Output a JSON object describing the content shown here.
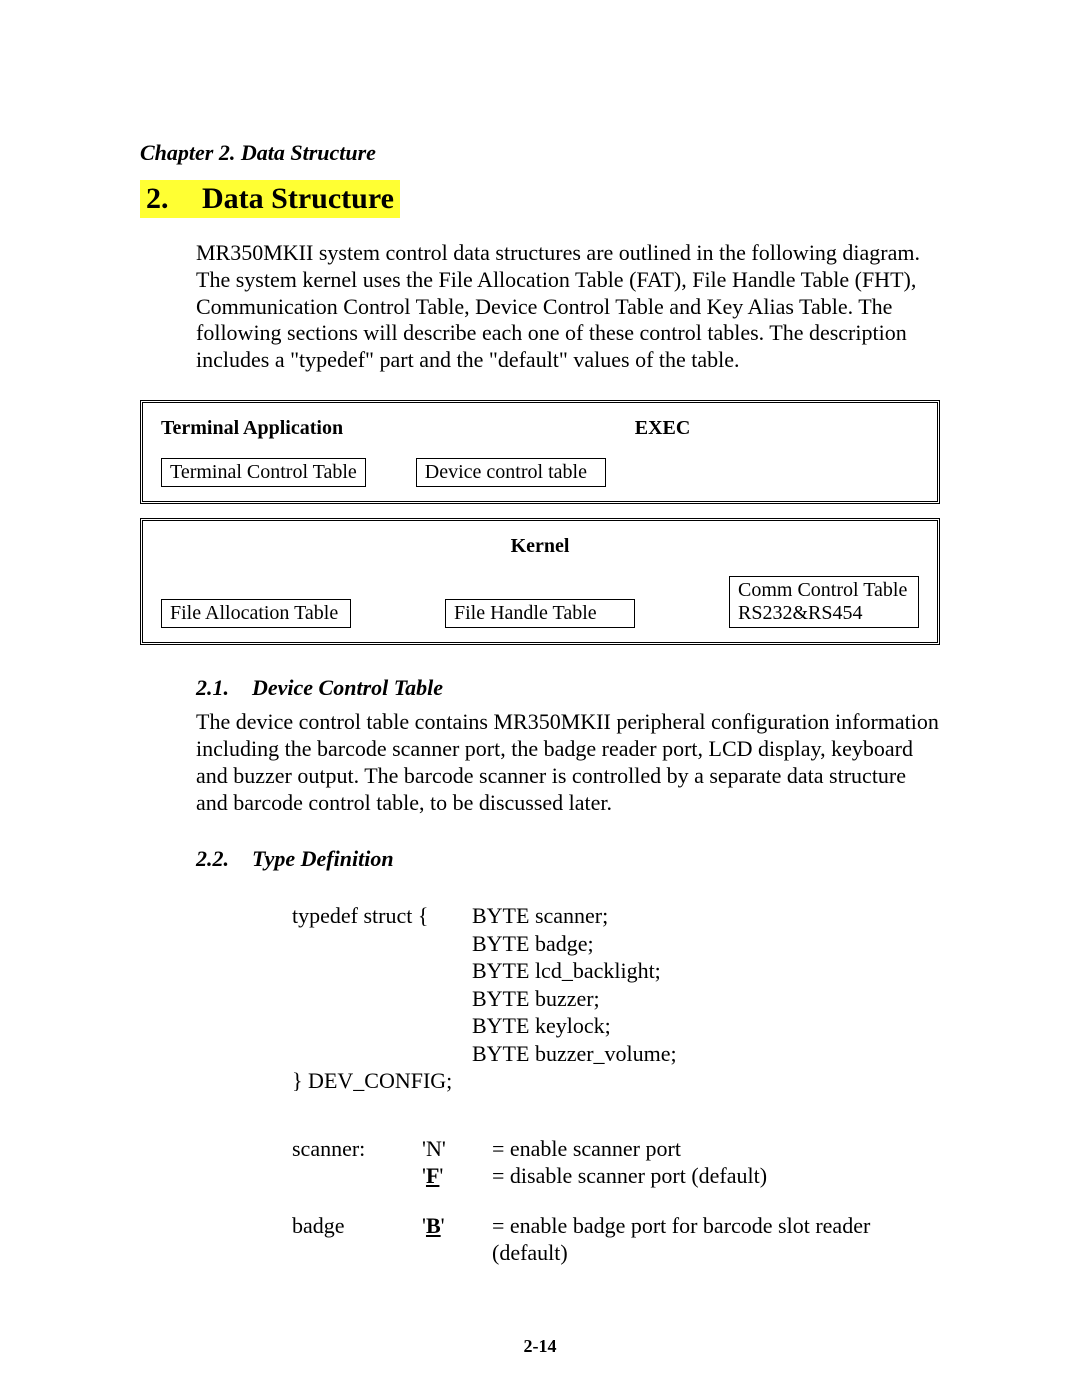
{
  "running_head": "Chapter 2. Data Structure",
  "chapter": {
    "number": "2.",
    "title": "Data Structure"
  },
  "intro_para": "MR350MKII system control data structures are outlined in the following diagram. The system kernel uses the File Allocation Table (FAT), File Handle Table (FHT), Communication Control Table, Device Control Table and Key Alias Table.  The following sections will describe each one of these control tables. The description includes a \"typedef\" part and the \"default\" values of the table.",
  "diagram": {
    "box1": {
      "header_left": "Terminal Application",
      "header_right": "EXEC",
      "cells": [
        "Terminal Control Table",
        "Device control table"
      ]
    },
    "box2": {
      "header_center": "Kernel",
      "cells": [
        "File Allocation Table",
        "File Handle Table",
        {
          "line1": "Comm Control Table",
          "line2": "RS232&RS454"
        }
      ]
    }
  },
  "sections": {
    "s1": {
      "num": "2.1.",
      "title": "Device Control Table",
      "para": "The device control table contains MR350MKII peripheral configuration information including the barcode scanner port, the badge reader port, LCD display, keyboard and buzzer output. The barcode scanner is controlled by a separate data structure and barcode control table, to be discussed later."
    },
    "s2": {
      "num": "2.2.",
      "title": "Type Definition"
    }
  },
  "typedef": {
    "open": "typedef struct {",
    "members": [
      "BYTE  scanner;",
      "BYTE  badge;",
      "BYTE  lcd_backlight;",
      "BYTE  buzzer;",
      "BYTE  keylock;",
      "BYTE  buzzer_volume;"
    ],
    "close": "} DEV_CONFIG;"
  },
  "defs": [
    {
      "field": "scanner:",
      "code": "'N'",
      "code_style": "plain",
      "desc": "= enable scanner port"
    },
    {
      "field": "",
      "code": "'F'",
      "code_style": "bold-u",
      "desc": "= disable scanner port (default)"
    },
    {
      "field": "badge",
      "code": "'B'",
      "code_style": "bold-u",
      "desc": "= enable badge port for barcode slot reader (default)"
    }
  ],
  "page_number": "2-14"
}
